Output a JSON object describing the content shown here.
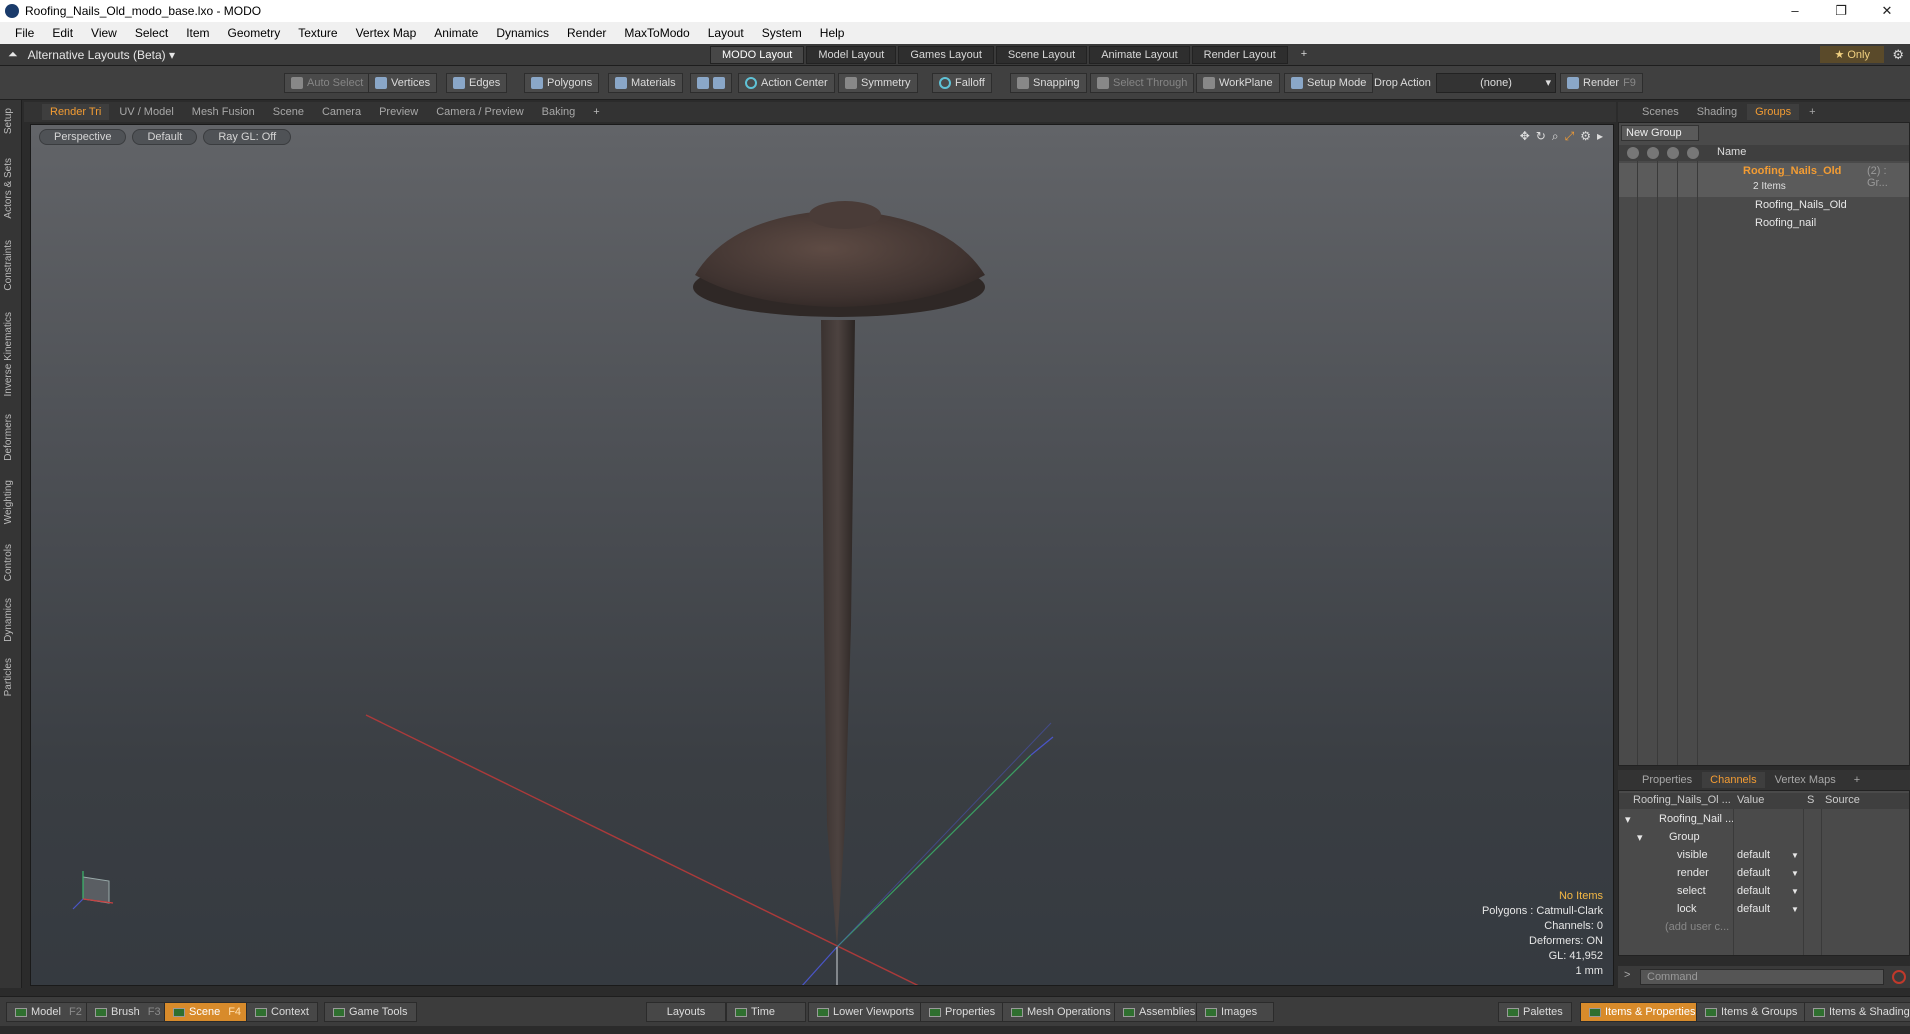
{
  "window": {
    "title": "Roofing_Nails_Old_modo_base.lxo - MODO",
    "controls": [
      "–",
      "❐",
      "✕"
    ]
  },
  "menubar": [
    "File",
    "Edit",
    "View",
    "Select",
    "Item",
    "Geometry",
    "Texture",
    "Vertex Map",
    "Animate",
    "Dynamics",
    "Render",
    "MaxToModo",
    "Layout",
    "System",
    "Help"
  ],
  "layoutbar": {
    "alt_layouts": "Alternative Layouts (Beta) ▾",
    "tabs": [
      "MODO Layout",
      "Model Layout",
      "Games Layout",
      "Scene Layout",
      "Animate Layout",
      "Render Layout",
      "+"
    ],
    "only": "★  Only"
  },
  "toolbar": {
    "auto_select": "Auto Select",
    "vertices": "Vertices",
    "edges": "Edges",
    "polygons": "Polygons",
    "materials": "Materials",
    "action_center": "Action Center",
    "symmetry": "Symmetry",
    "falloff": "Falloff",
    "snapping": "Snapping",
    "select_through": "Select Through",
    "workplane": "WorkPlane",
    "setup_mode": "Setup Mode",
    "drop_action": "Drop Action",
    "drop_value": "(none)",
    "render": "Render",
    "render_key": "F9"
  },
  "left_strip": [
    "Setup",
    "Actors & Sets",
    "Constraints",
    "Inverse Kinematics",
    "Deformers",
    "Weighting",
    "Controls",
    "Dynamics",
    "Particles"
  ],
  "viewport_tabs": [
    "Render Tri",
    "UV / Model",
    "Mesh Fusion",
    "Scene",
    "Camera",
    "Preview",
    "Camera / Preview",
    "Baking",
    "+"
  ],
  "viewport": {
    "view": "Perspective",
    "shading": "Default",
    "raygl": "Ray GL: Off",
    "info": {
      "no_items": "No Items",
      "polygons": "Polygons : Catmull-Clark",
      "channels": "Channels: 0",
      "deformers": "Deformers: ON",
      "gl": "GL: 41,952",
      "scale": "1 mm"
    }
  },
  "right_tabs": [
    "Scenes",
    "Shading",
    "Groups",
    "+"
  ],
  "groups": {
    "new_group": "New Group",
    "name_header": "Name",
    "group_name": "Roofing_Nails_Old",
    "group_count": "(2) : Gr...",
    "items_count": "2 Items",
    "children": [
      "Roofing_Nails_Old",
      "Roofing_nail"
    ]
  },
  "props_tabs": [
    "Properties",
    "Channels",
    "Vertex Maps",
    "+"
  ],
  "channels": {
    "headers": {
      "name": "Roofing_Nails_Ol ...",
      "value": "Value",
      "s": "S",
      "source": "Source"
    },
    "root": "Roofing_Nail ...",
    "group": "Group",
    "rows": [
      {
        "name": "visible",
        "value": "default"
      },
      {
        "name": "render",
        "value": "default"
      },
      {
        "name": "select",
        "value": "default"
      },
      {
        "name": "lock",
        "value": "default"
      }
    ],
    "add_user": "(add user c..."
  },
  "command": {
    "placeholder": "Command"
  },
  "bottombar": {
    "model": "Model",
    "model_key": "F2",
    "brush": "Brush",
    "brush_key": "F3",
    "scene": "Scene",
    "scene_key": "F4",
    "context": "Context",
    "game_tools": "Game Tools",
    "layouts": "Layouts",
    "time": "Time",
    "lower_viewports": "Lower Viewports",
    "properties": "Properties",
    "mesh_operations": "Mesh Operations",
    "assemblies": "Assemblies",
    "images": "Images",
    "palettes": "Palettes",
    "items_properties": "Items & Properties",
    "items_groups": "Items & Groups",
    "items_shading": "Items & Shading"
  },
  "colors": {
    "accent": "#f39c33",
    "active_button": "#d88b2b",
    "viewport_top": "#626468",
    "viewport_bottom": "#353a40"
  }
}
